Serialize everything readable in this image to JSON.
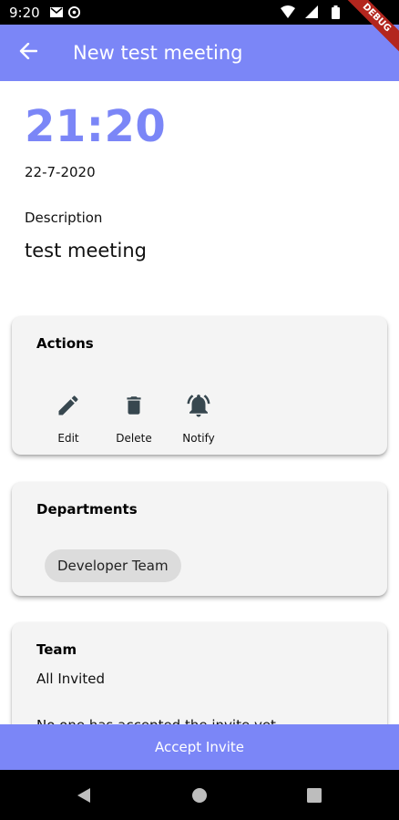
{
  "status_bar": {
    "time": "9:20",
    "icons": [
      "gmail-icon",
      "sync-icon",
      "wifi-icon",
      "signal-icon",
      "battery-icon"
    ]
  },
  "debug_banner": "DEBUG",
  "app_bar": {
    "title": "New test meeting",
    "back_icon": "arrow-left-icon"
  },
  "meeting": {
    "time": "21:20",
    "date": "22-7-2020",
    "description_label": "Description",
    "description": "test meeting"
  },
  "actions_card": {
    "title": "Actions",
    "items": [
      {
        "label": "Edit",
        "icon": "pencil-icon"
      },
      {
        "label": "Delete",
        "icon": "trash-icon"
      },
      {
        "label": "Notify",
        "icon": "bell-ring-icon"
      }
    ]
  },
  "departments_card": {
    "title": "Departments",
    "chips": [
      "Developer Team"
    ]
  },
  "team_card": {
    "title": "Team",
    "invited_text": "All Invited",
    "status_text": "No one has accepted the invite yet"
  },
  "accept_button": "Accept Invite",
  "nav_bar": {
    "icons": [
      "back-triangle-icon",
      "home-circle-icon",
      "recents-square-icon"
    ]
  },
  "colors": {
    "primary": "#7b86f7",
    "card_bg": "#f4f4f4",
    "icon_dark": "#37474f"
  }
}
